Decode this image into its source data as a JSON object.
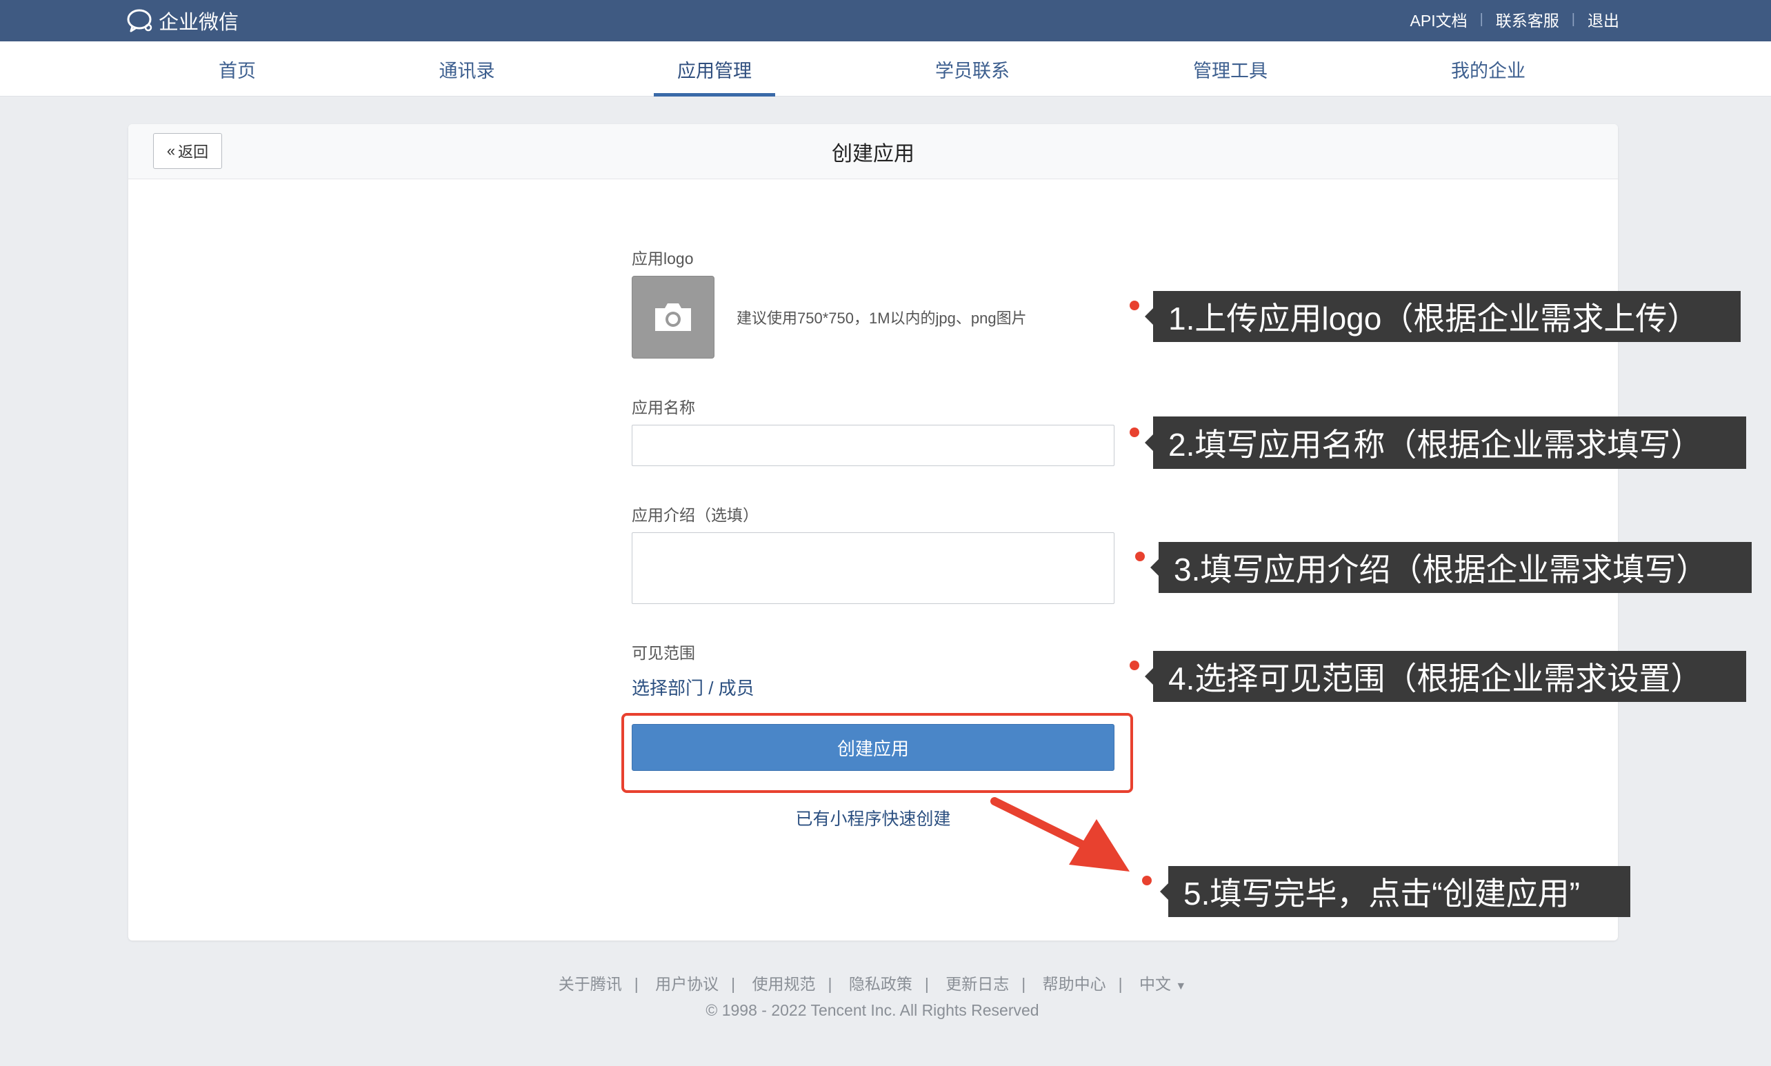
{
  "header": {
    "brand": "企业微信",
    "links": [
      "API文档",
      "联系客服",
      "退出"
    ]
  },
  "nav": {
    "items": [
      "首页",
      "通讯录",
      "应用管理",
      "学员联系",
      "管理工具",
      "我的企业"
    ],
    "active": "应用管理"
  },
  "page": {
    "back_label": "返回",
    "title": "创建应用"
  },
  "form": {
    "logo_label": "应用logo",
    "logo_hint": "建议使用750*750，1M以内的jpg、png图片",
    "name_label": "应用名称",
    "name_value": "",
    "intro_label": "应用介绍（选填）",
    "intro_value": "",
    "scope_label": "可见范围",
    "scope_link": "选择部门 / 成员",
    "create_button": "创建应用",
    "mini_program_link": "已有小程序快速创建"
  },
  "annotations": [
    "1.上传应用logo（根据企业需求上传）",
    "2.填写应用名称（根据企业需求填写）",
    "3.填写应用介绍（根据企业需求填写）",
    "4.选择可见范围（根据企业需求设置）",
    "5.填写完毕，点击“创建应用”"
  ],
  "footer": {
    "links": [
      "关于腾讯",
      "用户协议",
      "使用规范",
      "隐私政策",
      "更新日志",
      "帮助中心",
      "中文"
    ],
    "language_caret": "▼",
    "copyright": "© 1998 - 2022 Tencent Inc. All Rights Reserved"
  },
  "colors": {
    "topbar": "#3f5a82",
    "accent": "#4a86c8",
    "highlight": "#e8412f",
    "callout_bg": "#3a3a3a"
  }
}
